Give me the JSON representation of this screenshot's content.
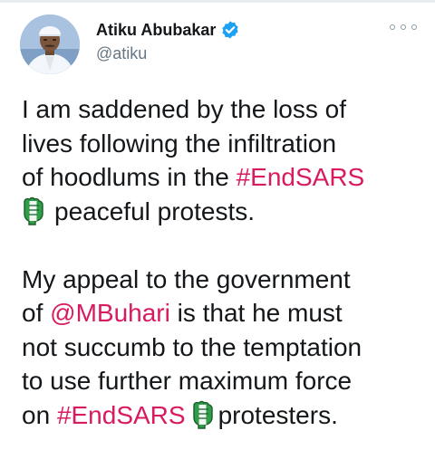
{
  "author": {
    "display_name": "Atiku Abubakar",
    "handle": "@atiku",
    "verified": true,
    "avatar_icon": "profile-photo"
  },
  "menu_icon": "more-options-icon",
  "tweet": {
    "p1": {
      "l1": "I am saddened by the loss of",
      "l2": "lives following the infiltration",
      "l3_pre": "of hoodlums in the ",
      "l3_tag": "#EndSARS",
      "l4_emoji": "raised-fist-emoji",
      "l4": "peaceful protests."
    },
    "p2": {
      "l1": "My appeal to the government",
      "l2_pre": "of ",
      "l2_mention": "@MBuhari",
      "l2_post": " is that he must",
      "l3": "not succumb to the temptation",
      "l4": "to use further maximum force",
      "l5_pre": "on ",
      "l5_tag": "#EndSARS",
      "l5_emoji": "raised-fist-emoji",
      "l5_post": "protesters."
    }
  },
  "colors": {
    "link": "#d81b60",
    "verified": "#1da1f2",
    "text": "#14171a",
    "secondary": "#657786"
  }
}
